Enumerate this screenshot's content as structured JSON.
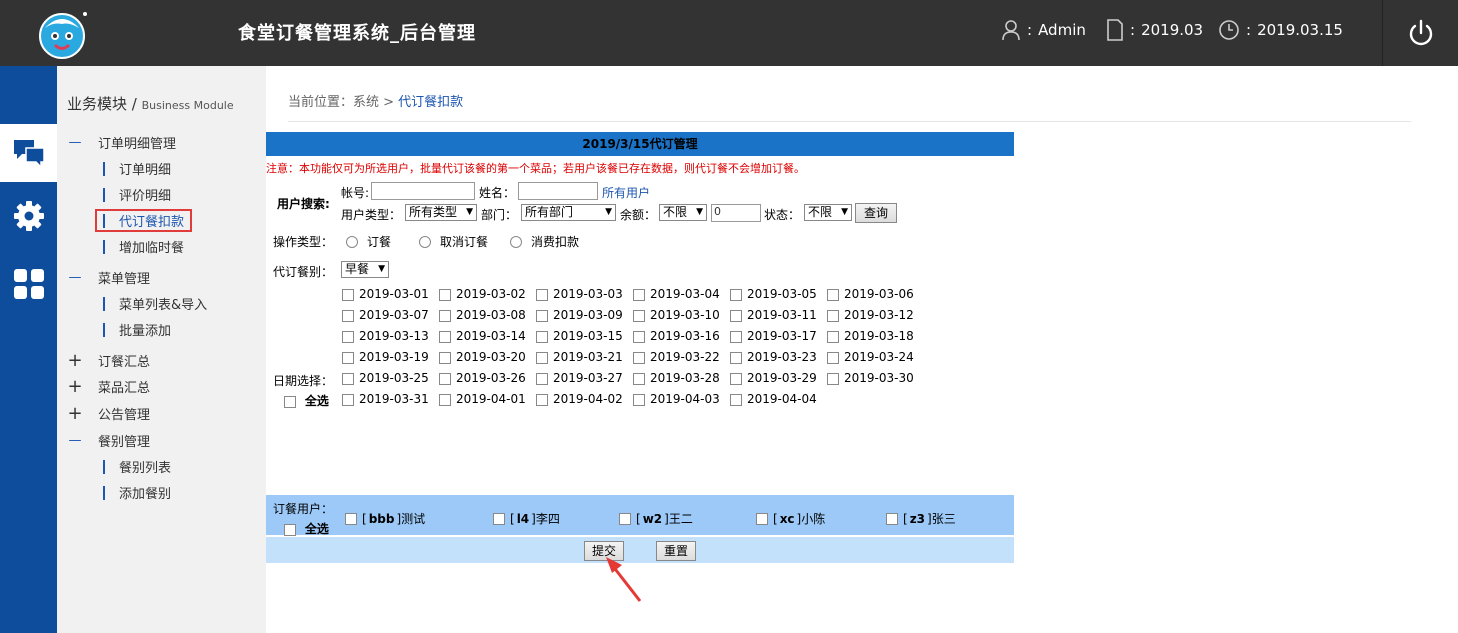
{
  "header": {
    "title": "食堂订餐管理系统_后台管理",
    "user_sep": ":",
    "user": "Admin",
    "month": "2019.03",
    "date": "2019.03.15"
  },
  "iconbar": [
    "chat-icon",
    "gear-icon",
    "grid-icon"
  ],
  "sidebar": {
    "title": "业务模块 /",
    "title_en": "Business Module",
    "groups": [
      {
        "label": "订单明细管理",
        "expanded": true,
        "items": [
          "订单明细",
          "评价明细",
          "代订餐扣款",
          "增加临时餐"
        ]
      },
      {
        "label": "菜单管理",
        "expanded": true,
        "items": [
          "菜单列表&导入",
          "批量添加"
        ]
      },
      {
        "label": "订餐汇总",
        "expanded": false
      },
      {
        "label": "菜品汇总",
        "expanded": false
      },
      {
        "label": "公告管理",
        "expanded": false
      },
      {
        "label": "餐别管理",
        "expanded": true,
        "items": [
          "餐别列表",
          "添加餐别"
        ]
      }
    ]
  },
  "breadcrumb": {
    "prefix": "当前位置：系统 >",
    "current": "代订餐扣款"
  },
  "panel": {
    "title": "2019/3/15代订管理",
    "notice": "注意：本功能仅可为所选用户，批量代订该餐的第一个菜品；若用户该餐已存在数据，则代订餐不会增加订餐。",
    "search": {
      "label": "用户搜索:",
      "account_label": "帐号:",
      "account_value": "",
      "name_label": "姓名：",
      "name_value": "",
      "all_users_link": "所有用户",
      "type_label": "用户类型：",
      "type_value": "所有类型",
      "dept_label": "部门：",
      "dept_value": "所有部门",
      "balance_label": "余额：",
      "balance_op": "不限",
      "balance_value": "0",
      "status_label": "状态：",
      "status_value": "不限",
      "query_button": "查询"
    },
    "op": {
      "label": "操作类型：",
      "options": [
        "订餐",
        "取消订餐",
        "消费扣款"
      ]
    },
    "meal": {
      "label": "代订餐别：",
      "value": "早餐"
    },
    "dates": {
      "label": "日期选择：",
      "select_all": "全选",
      "items": [
        "2019-03-01",
        "2019-03-02",
        "2019-03-03",
        "2019-03-04",
        "2019-03-05",
        "2019-03-06",
        "2019-03-07",
        "2019-03-08",
        "2019-03-09",
        "2019-03-10",
        "2019-03-11",
        "2019-03-12",
        "2019-03-13",
        "2019-03-14",
        "2019-03-15",
        "2019-03-16",
        "2019-03-17",
        "2019-03-18",
        "2019-03-19",
        "2019-03-20",
        "2019-03-21",
        "2019-03-22",
        "2019-03-23",
        "2019-03-24",
        "2019-03-25",
        "2019-03-26",
        "2019-03-27",
        "2019-03-28",
        "2019-03-29",
        "2019-03-30",
        "2019-03-31",
        "2019-04-01",
        "2019-04-02",
        "2019-04-03",
        "2019-04-04"
      ]
    },
    "users": {
      "label": "订餐用户：",
      "select_all": "全选",
      "items": [
        {
          "code": "bbb",
          "name": "测试"
        },
        {
          "code": "l4",
          "name": "李四"
        },
        {
          "code": "w2",
          "name": "王二"
        },
        {
          "code": "xc",
          "name": "小陈"
        },
        {
          "code": "z3",
          "name": "张三"
        }
      ]
    },
    "submit_button": "提交",
    "reset_button": "重置"
  },
  "colors": {
    "header_bg": "#333333",
    "iconbar_bg": "#0e4c9c",
    "accent": "#1d56b0",
    "title_bar": "#1a73c6",
    "notice": "#dd0000",
    "users_bg": "#9cc9f7",
    "highlight": "#e03c3c"
  }
}
